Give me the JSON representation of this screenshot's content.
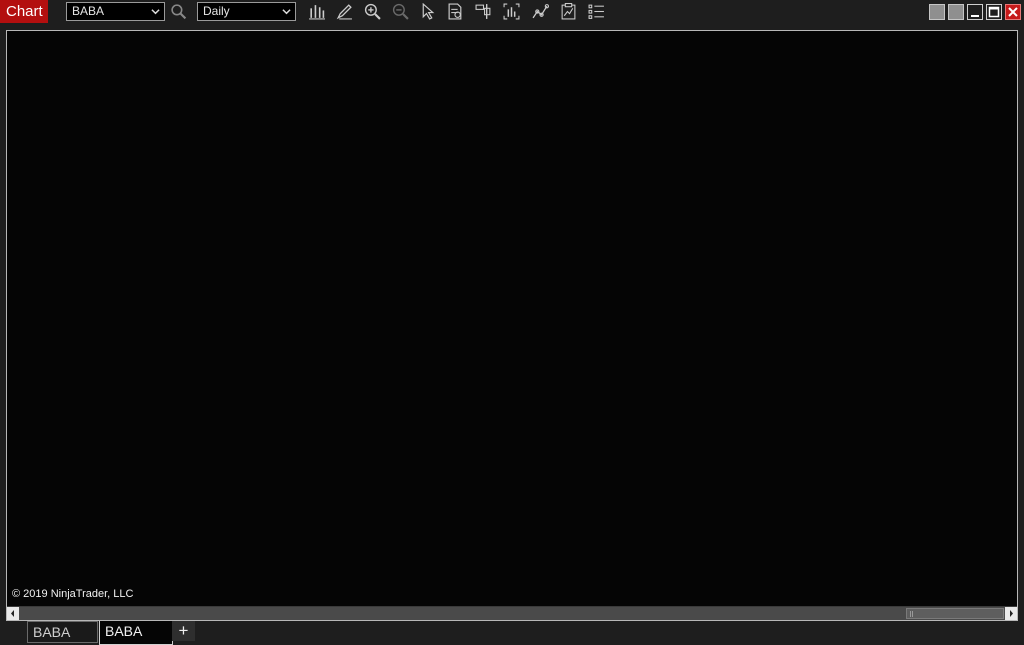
{
  "app": {
    "title": "Chart"
  },
  "toolbar": {
    "instrument": {
      "value": "BABA"
    },
    "interval": {
      "value": "Daily"
    },
    "icons": [
      "search-icon",
      "bar-chart-style-icon",
      "drawing-tools-icon",
      "zoom-in-icon",
      "zoom-out-icon",
      "pointer-icon",
      "data-box-icon",
      "chart-trader-icon",
      "bar-series-icon",
      "strategies-icon",
      "templates-icon",
      "properties-list-icon"
    ]
  },
  "chart": {
    "copyright": "© 2019 NinjaTrader, LLC"
  },
  "tabs": [
    {
      "label": "BABA",
      "active": false
    },
    {
      "label": "BABA",
      "active": true
    }
  ],
  "add_tab_label": "+",
  "colors": {
    "accent": "#b30f0f",
    "background": "#1e1e1e",
    "chart_background": "#050505",
    "close_button": "#c61a1a"
  }
}
